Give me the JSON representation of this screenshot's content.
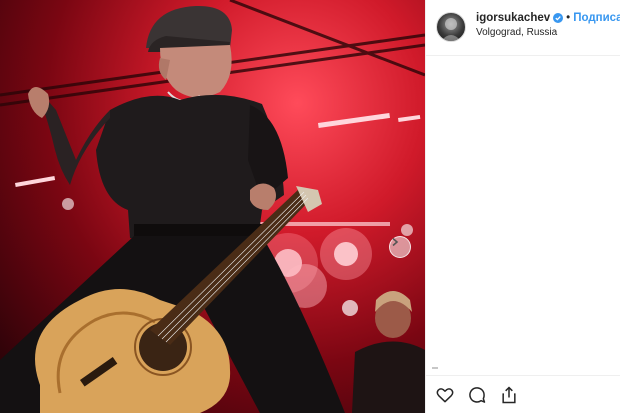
{
  "post": {
    "username": "igorsukachev",
    "separator": "•",
    "follow_label": "Подписа",
    "location": "Volgograd, Russia"
  },
  "icons": {
    "verified": "verified-badge-icon",
    "carousel_next": "chevron-right-icon",
    "like": "heart-icon",
    "comment": "comment-bubble-icon",
    "share": "share-icon"
  },
  "colors": {
    "accent": "#3897f0",
    "stage_red": "#d01a2a",
    "text": "#262626"
  }
}
